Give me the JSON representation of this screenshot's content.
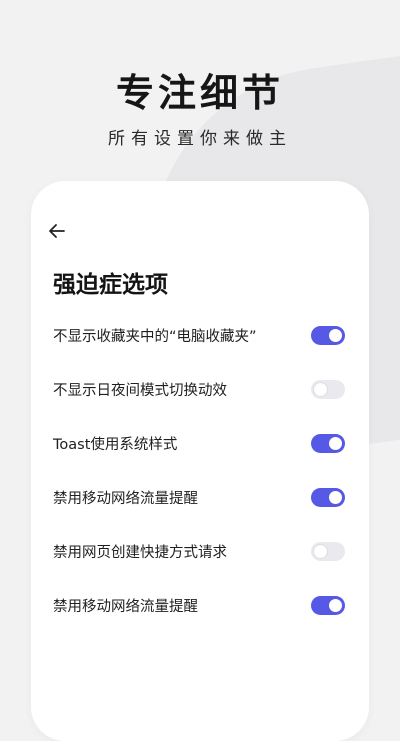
{
  "hero": {
    "title": "专注细节",
    "subtitle": "所有设置你来做主"
  },
  "screen": {
    "title": "强迫症选项",
    "back_icon": "arrow-left-icon",
    "settings": [
      {
        "label": "不显示收藏夹中的“电脑收藏夹”",
        "on": true
      },
      {
        "label": "不显示日夜间模式切换动效",
        "on": false
      },
      {
        "label": "Toast使用系统样式",
        "on": true
      },
      {
        "label": "禁用移动网络流量提醒",
        "on": true
      },
      {
        "label": "禁用网页创建快捷方式请求",
        "on": false
      },
      {
        "label": "禁用移动网络流量提醒",
        "on": true
      }
    ]
  },
  "colors": {
    "accent": "#5559e6",
    "toggle_off": "#e9e9ee",
    "background": "#f2f2f3"
  }
}
